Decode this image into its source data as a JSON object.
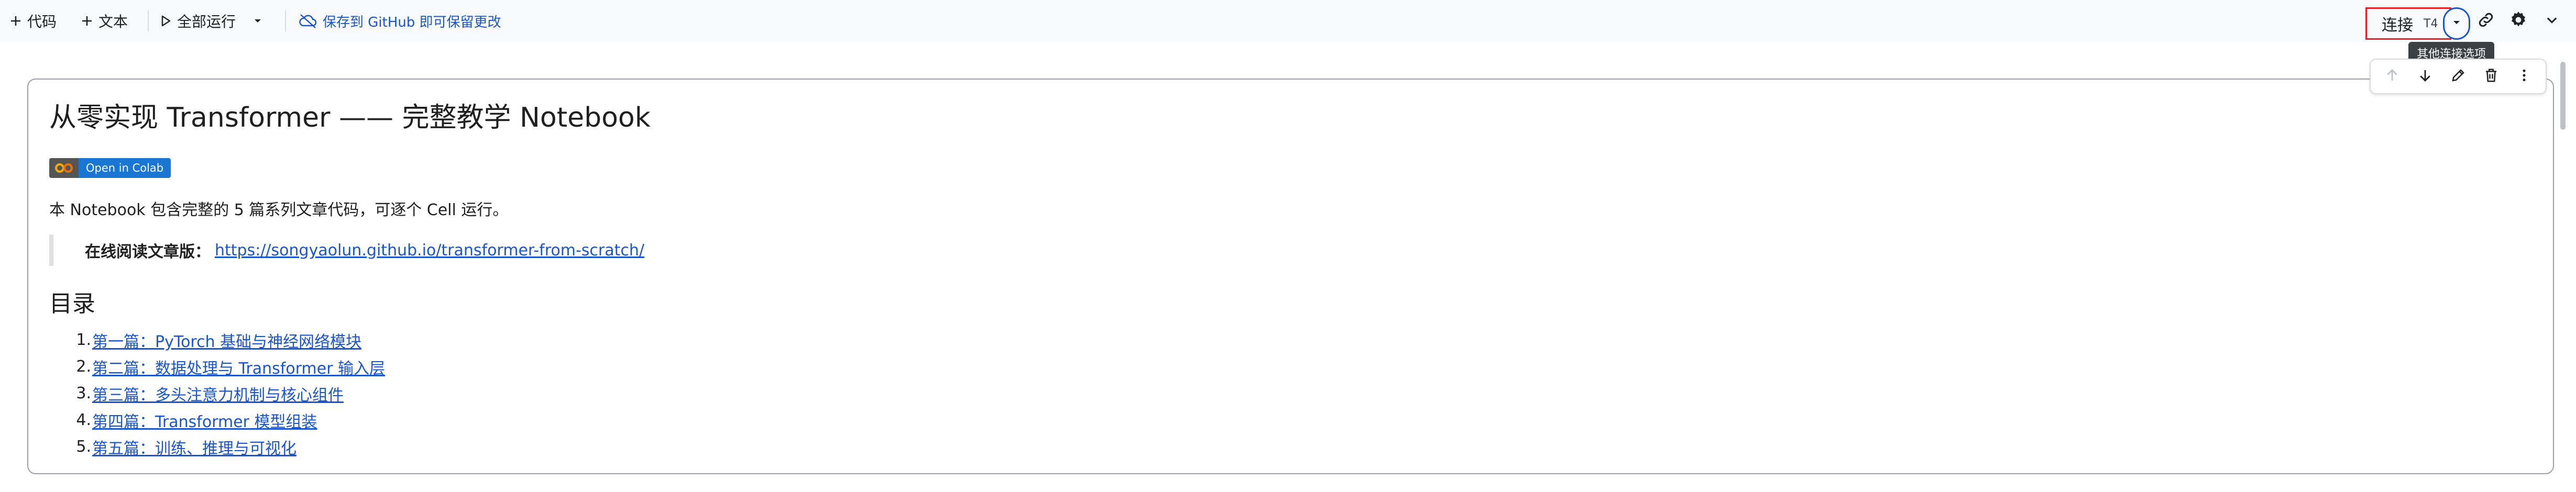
{
  "toolbar": {
    "add_code": "代码",
    "add_text": "文本",
    "run_all": "全部运行",
    "save_github": "保存到 GitHub 即可保留更改",
    "connect_label": "连接",
    "connect_gpu": "T4",
    "connect_more_tooltip": "其他连接选项"
  },
  "icons": {
    "add_code": "plus-icon",
    "add_text": "plus-icon",
    "run_all": "play-icon",
    "run_all_dropdown": "chevron-down-icon",
    "save_github": "cloud-off-icon",
    "connect_dropdown": "chevron-down-icon",
    "link": "link-icon",
    "settings": "gear-icon",
    "expand": "chevron-down-icon",
    "cell_up": "arrow-up-icon",
    "cell_down": "arrow-down-icon",
    "cell_edit": "pencil-icon",
    "cell_delete": "trash-icon",
    "cell_more": "more-vert-icon"
  },
  "cell": {
    "title": "从零实现 Transformer —— 完整教学 Notebook",
    "badge_text": "Open in Colab",
    "intro": "本 Notebook 包含完整的 5 篇系列文章代码，可逐个 Cell 运行。",
    "quote_label": "在线阅读文章版：",
    "quote_link": "https://songyaolun.github.io/transformer-from-scratch/",
    "toc_heading": "目录",
    "toc": [
      {
        "num": "1.",
        "label": "第一篇：PyTorch 基础与神经网络模块"
      },
      {
        "num": "2.",
        "label": "第二篇：数据处理与 Transformer 输入层"
      },
      {
        "num": "3.",
        "label": "第三篇：多头注意力机制与核心组件"
      },
      {
        "num": "4.",
        "label": "第四篇：Transformer 模型组装"
      },
      {
        "num": "5.",
        "label": "第五篇：训练、推理与可视化"
      }
    ]
  },
  "colors": {
    "accent": "#1a56c7",
    "highlight_red": "#e0202a",
    "badge_blue": "#1976d2",
    "badge_gray": "#555555",
    "colab_orange": "#f9ab00"
  }
}
